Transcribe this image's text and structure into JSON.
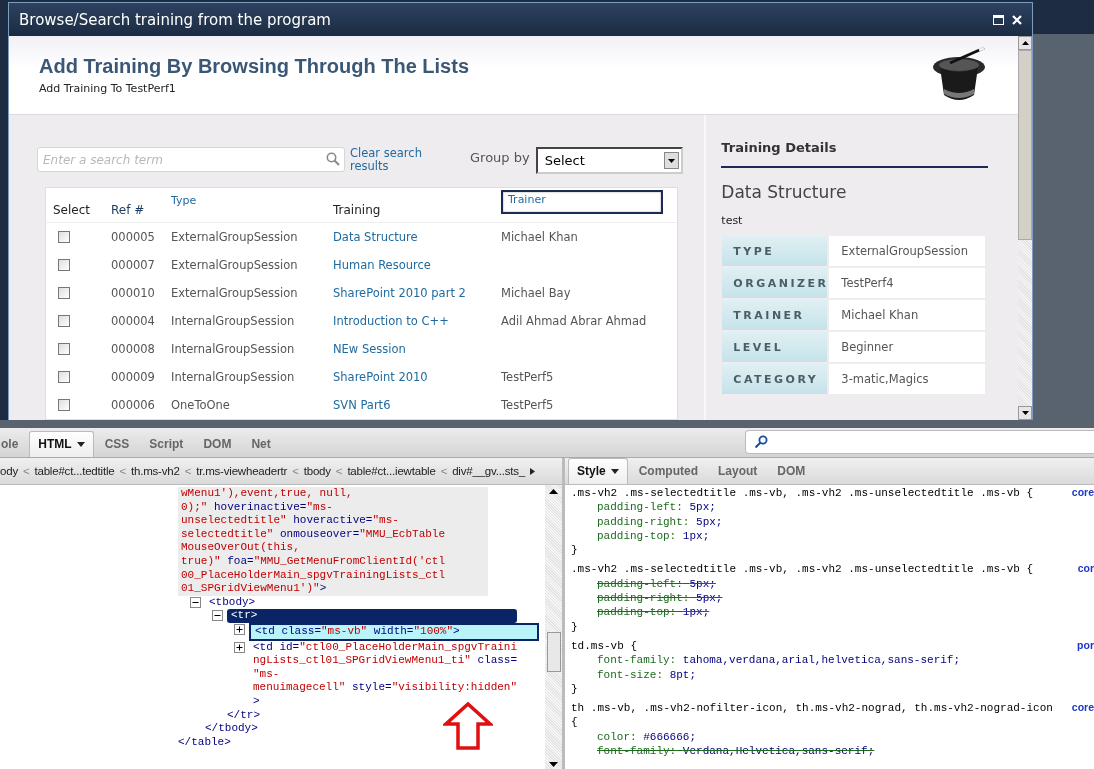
{
  "dialog": {
    "title": "Browse/Search training from the program",
    "heading": "Add Training By Browsing Through The Lists",
    "subheading": "Add Training To TestPerf1",
    "search": {
      "placeholder": "Enter a search term"
    },
    "clear_link": "Clear search results",
    "group_by": {
      "label": "Group by",
      "value": "Select"
    },
    "table": {
      "columns": [
        {
          "label": "Select",
          "kind": "plain"
        },
        {
          "label": "Ref #",
          "kind": "sort"
        },
        {
          "label": "Type",
          "kind": "menu"
        },
        {
          "label": "Training",
          "kind": "plain"
        },
        {
          "label": "Trainer",
          "kind": "focused"
        }
      ],
      "rows": [
        {
          "checked": false,
          "ref": "000005",
          "type": "ExternalGroupSession",
          "training": "Data Structure",
          "trainer": "Michael Khan"
        },
        {
          "checked": false,
          "ref": "000007",
          "type": "ExternalGroupSession",
          "training": "Human Resource"
        },
        {
          "checked": false,
          "ref": "000010",
          "type": "ExternalGroupSession",
          "training": "SharePoint 2010 part 2",
          "trainer": "Michael Bay"
        },
        {
          "checked": false,
          "ref": "000004",
          "type": "InternalGroupSession",
          "training": "Introduction to C++",
          "trainer": "Adil Ahmad Abrar Ahmad"
        },
        {
          "checked": false,
          "ref": "000008",
          "type": "InternalGroupSession",
          "training": "NEw Session"
        },
        {
          "checked": false,
          "ref": "000009",
          "type": "InternalGroupSession",
          "training": "SharePoint 2010",
          "trainer": "TestPerf5"
        },
        {
          "checked": false,
          "ref": "000006",
          "type": "OneToOne",
          "training": "SVN Part6",
          "trainer": "TestPerf5"
        }
      ]
    },
    "details": {
      "title": "Training Details",
      "name": "Data Structure",
      "description": "test",
      "fields": [
        {
          "label": "TYPE",
          "value": "ExternalGroupSession"
        },
        {
          "label": "ORGANIZER",
          "value": "TestPerf4"
        },
        {
          "label": "TRAINER",
          "value": "Michael Khan"
        },
        {
          "label": "LEVEL",
          "value": "Beginner"
        },
        {
          "label": "CATEGORY",
          "value": "3-matic,Magics"
        }
      ]
    }
  },
  "devtools": {
    "tabs": [
      {
        "label": "ole",
        "selected": false
      },
      {
        "label": "HTML",
        "selected": true
      },
      {
        "label": "CSS",
        "selected": false
      },
      {
        "label": "Script",
        "selected": false
      },
      {
        "label": "DOM",
        "selected": false
      },
      {
        "label": "Net",
        "selected": false
      }
    ],
    "breadcrumb_separator": "<",
    "breadcrumbs": [
      "ody",
      "table#ct...tedtitle",
      "th.ms-vh2",
      "tr.ms-viewheadertr",
      "tbody",
      "table#ct...iewtable",
      "div#__gv...sts_"
    ],
    "html_tree": {
      "lines": [
        [
          {
            "kind": "value",
            "text": "wMenu1'),event,true, null,"
          }
        ],
        [
          {
            "kind": "value",
            "text": "0);\""
          },
          {
            "kind": "tag",
            "text": " hoverinactive="
          },
          {
            "kind": "value",
            "text": "\"ms-"
          }
        ],
        [
          {
            "kind": "value",
            "text": "unselectedtitle\""
          },
          {
            "kind": "tag",
            "text": " hoveractive="
          },
          {
            "kind": "value",
            "text": "\"ms-"
          }
        ],
        [
          {
            "kind": "value",
            "text": "selectedtitle\""
          },
          {
            "kind": "tag",
            "text": " onmouseover="
          },
          {
            "kind": "value",
            "text": "\"MMU_EcbTable"
          }
        ],
        [
          {
            "kind": "value",
            "text": "MouseOverOut(this,"
          }
        ],
        [
          {
            "kind": "value",
            "text": "true)\""
          },
          {
            "kind": "tag",
            "text": " foa="
          },
          {
            "kind": "value",
            "text": "\"MMU_GetMenuFromClientId('ctl"
          }
        ],
        [
          {
            "kind": "value",
            "text": "00_PlaceHolderMain_spgvTrainingLists_ctl"
          }
        ],
        [
          {
            "kind": "value",
            "text": "01_SPGridViewMenu1')\""
          },
          {
            "kind": "tag",
            "text": ">"
          }
        ]
      ],
      "children": [
        {
          "expanded": true,
          "selected": false,
          "hovered": false,
          "lines": [
            [
              {
                "kind": "tag",
                "text": "<tbody>"
              }
            ]
          ],
          "close": "</tbody>",
          "children": [
            {
              "expanded": true,
              "selected": true,
              "hovered": false,
              "lines": [
                [
                  {
                    "kind": "tag",
                    "text": "<tr>"
                  }
                ]
              ],
              "close": "</tr>",
              "children": [
                {
                  "expanded": false,
                  "selected": false,
                  "hovered": true,
                  "lines": [
                    [
                      {
                        "kind": "tag",
                        "text": "<td class="
                      },
                      {
                        "kind": "value",
                        "text": "\"ms-vb\""
                      },
                      {
                        "kind": "tag",
                        "text": " width="
                      },
                      {
                        "kind": "value",
                        "text": "\"100%\""
                      },
                      {
                        "kind": "tag",
                        "text": ">"
                      }
                    ]
                  ]
                },
                {
                  "expanded": false,
                  "selected": false,
                  "hovered": false,
                  "lines": [
                    [
                      {
                        "kind": "tag",
                        "text": "<td id="
                      },
                      {
                        "kind": "value",
                        "text": "\"ctl00_PlaceHolderMain_spgvTraini"
                      }
                    ],
                    [
                      {
                        "kind": "value",
                        "text": "ngLists_ctl01_SPGridViewMenu1_ti\""
                      },
                      {
                        "kind": "tag",
                        "text": " class="
                      }
                    ],
                    [
                      {
                        "kind": "value",
                        "text": "\"ms-"
                      }
                    ],
                    [
                      {
                        "kind": "value",
                        "text": "menuimagecell\""
                      },
                      {
                        "kind": "tag",
                        "text": " style="
                      },
                      {
                        "kind": "value",
                        "text": "\"visibility:hidden\""
                      }
                    ],
                    [
                      {
                        "kind": "tag",
                        "text": ">"
                      }
                    ]
                  ]
                }
              ]
            }
          ]
        }
      ],
      "close": "</table>"
    },
    "style_tabs": [
      {
        "label": "Style",
        "selected": true
      },
      {
        "label": "Computed",
        "selected": false
      },
      {
        "label": "Layout",
        "selected": false
      },
      {
        "label": "DOM",
        "selected": false
      }
    ],
    "rules": [
      {
        "selector": ".ms-vh2 .ms-selectedtitle .ms-vb, .ms-vh2 .ms-unselectedtitle .ms-vb {",
        "source": "core",
        "close": "}",
        "declarations": [
          {
            "property": "padding-left:",
            "value": "5px;",
            "overridden": false
          },
          {
            "property": "padding-right:",
            "value": "5px;",
            "overridden": false
          },
          {
            "property": "padding-top:",
            "value": "1px;",
            "overridden": false
          }
        ]
      },
      {
        "selector": ".ms-vh2 .ms-selectedtitle .ms-vb, .ms-vh2 .ms-unselectedtitle .ms-vb {",
        "source": "cor",
        "close": "}",
        "declarations": [
          {
            "property": "padding-left:",
            "value": "5px;",
            "overridden": true
          },
          {
            "property": "padding-right:",
            "value": "5px;",
            "overridden": true
          },
          {
            "property": "padding-top:",
            "value": "1px;",
            "overridden": true
          }
        ]
      },
      {
        "selector": "td.ms-vb {",
        "source": "por",
        "close": "}",
        "declarations": [
          {
            "property": "font-family:",
            "value": "tahoma,verdana,arial,helvetica,sans-serif;",
            "overridden": false
          },
          {
            "property": "font-size:",
            "value": "8pt;",
            "overridden": false
          }
        ]
      },
      {
        "selector": "th .ms-vb, .ms-vh2-nofilter-icon, th.ms-vh2-nograd, th.ms-vh2-nograd-icon {",
        "source": "core",
        "declarations": [
          {
            "property": "color:",
            "value": "#666666;",
            "overridden": false
          },
          {
            "property": "font-family:",
            "value": "Verdana,Helvetica,sans-serif;",
            "overridden": true
          }
        ]
      }
    ]
  }
}
